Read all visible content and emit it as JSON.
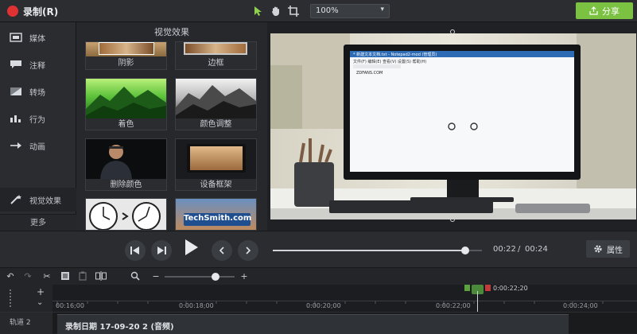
{
  "topbar": {
    "record_label": "录制(R)",
    "zoom_value": "100%",
    "share_label": "分享"
  },
  "sidebar": {
    "items": [
      {
        "label": "媒体",
        "icon": "media-icon"
      },
      {
        "label": "注释",
        "icon": "annotation-icon"
      },
      {
        "label": "转场",
        "icon": "transition-icon"
      },
      {
        "label": "行为",
        "icon": "behavior-icon"
      },
      {
        "label": "动画",
        "icon": "animation-icon"
      },
      {
        "label": "视觉效果",
        "icon": "visual-effects-icon"
      }
    ],
    "more_label": "更多"
  },
  "effects_panel": {
    "title": "视觉效果",
    "items": [
      {
        "label": "阴影"
      },
      {
        "label": "边框"
      },
      {
        "label": "着色"
      },
      {
        "label": "颜色调整"
      },
      {
        "label": "删除颜色"
      },
      {
        "label": "设备框架"
      },
      {
        "label": ""
      },
      {
        "label": "TechSmith.com"
      }
    ]
  },
  "preview": {
    "notepad_title": "* 新建文本文档.txt - Notepad2-mod (管理员)",
    "notepad_menu": "文件(F)  编辑(E)  查看(V)  设置(S)  帮助(H)",
    "notepad_text": "ZDFANS.COM"
  },
  "playback": {
    "current_time": "00:22",
    "separator": "/",
    "total_time": "00:24",
    "properties_label": "属性",
    "scrub_progress": 0.92
  },
  "timeline": {
    "ruler_labels": [
      "00:16;00",
      "0:00:18;00",
      "0:00:20;00",
      "0:00:22;00",
      "0:00:24;00"
    ],
    "playhead_time": "0:00:22;20",
    "track_label": "轨道 2",
    "clip_label": "录制日期 17-09-20 2 (音频)"
  },
  "colors": {
    "accent_green": "#7cc242",
    "record_red": "#e03232"
  }
}
